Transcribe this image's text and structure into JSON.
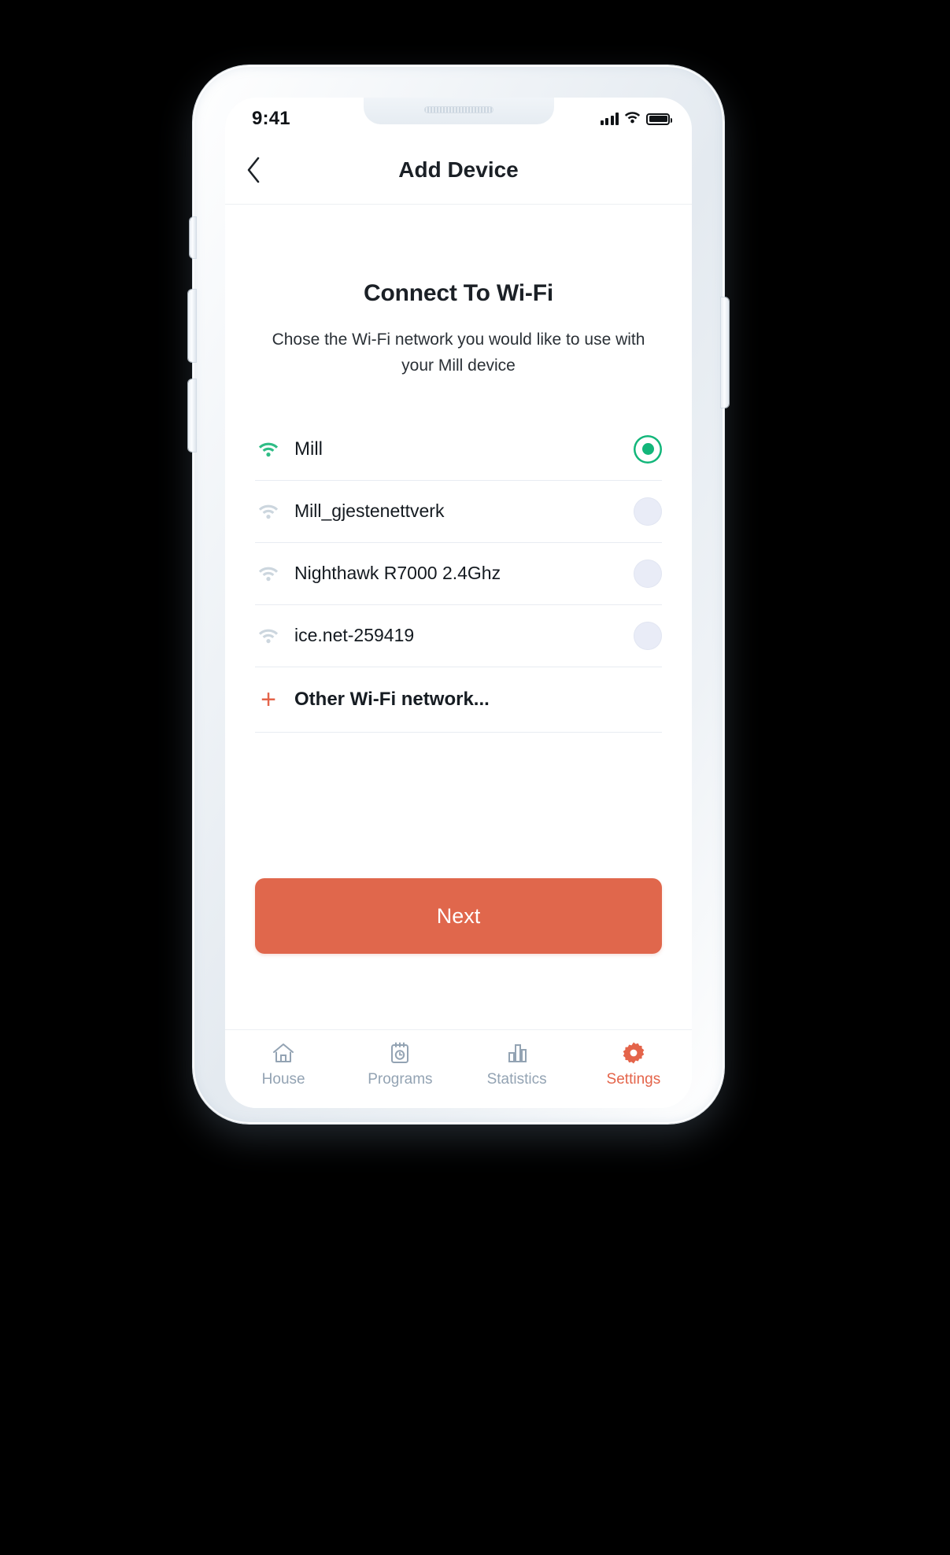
{
  "colors": {
    "accent": "#e4644a",
    "next_button": "#e0674c",
    "selected_green": "#12b67a",
    "muted": "#93a3b3",
    "radio_off": "#e9ecf7"
  },
  "status_bar": {
    "time": "9:41",
    "signal_icon": "cellular-bars-icon",
    "wifi_icon": "wifi-icon",
    "battery_icon": "battery-full-icon"
  },
  "nav": {
    "back_icon": "chevron-left-icon",
    "title": "Add Device"
  },
  "main": {
    "headline": "Connect To Wi-Fi",
    "subhead": "Chose the Wi-Fi network you would like  to use with your Mill device"
  },
  "wifi_networks": [
    {
      "ssid": "Mill",
      "selected": true,
      "signal": "strong"
    },
    {
      "ssid": "Mill_gjestenettverk",
      "selected": false,
      "signal": "weak"
    },
    {
      "ssid": "Nighthawk R7000 2.4Ghz",
      "selected": false,
      "signal": "weak"
    },
    {
      "ssid": "ice.net-259419",
      "selected": false,
      "signal": "weak"
    }
  ],
  "other_network": {
    "plus_icon": "plus-icon",
    "label": "Other Wi-Fi network..."
  },
  "primary_action": {
    "label": "Next"
  },
  "tab_bar": {
    "items": [
      {
        "label": "House",
        "icon": "home-icon",
        "active": false
      },
      {
        "label": "Programs",
        "icon": "calendar-clock-icon",
        "active": false
      },
      {
        "label": "Statistics",
        "icon": "bar-chart-icon",
        "active": false
      },
      {
        "label": "Settings",
        "icon": "gear-icon",
        "active": true
      }
    ]
  }
}
